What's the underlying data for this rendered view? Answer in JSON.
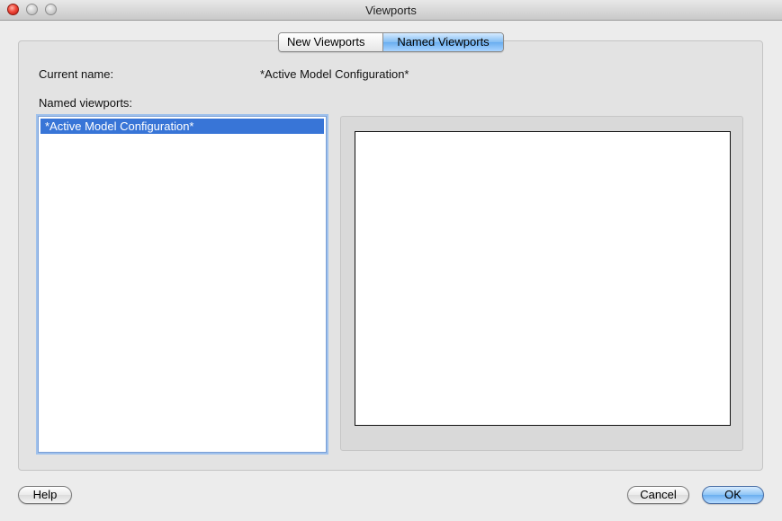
{
  "window": {
    "title": "Viewports"
  },
  "tabs": [
    {
      "label": "New Viewports",
      "active": false
    },
    {
      "label": "Named Viewports",
      "active": true
    }
  ],
  "current": {
    "label": "Current name:",
    "value": "*Active Model Configuration*"
  },
  "named_viewports": {
    "label": "Named viewports:",
    "items": [
      {
        "label": "*Active Model Configuration*",
        "selected": true
      }
    ]
  },
  "buttons": {
    "help": "Help",
    "cancel": "Cancel",
    "ok": "OK"
  },
  "colors": {
    "selection": "#3875d7",
    "accent": "#6aaef0"
  }
}
